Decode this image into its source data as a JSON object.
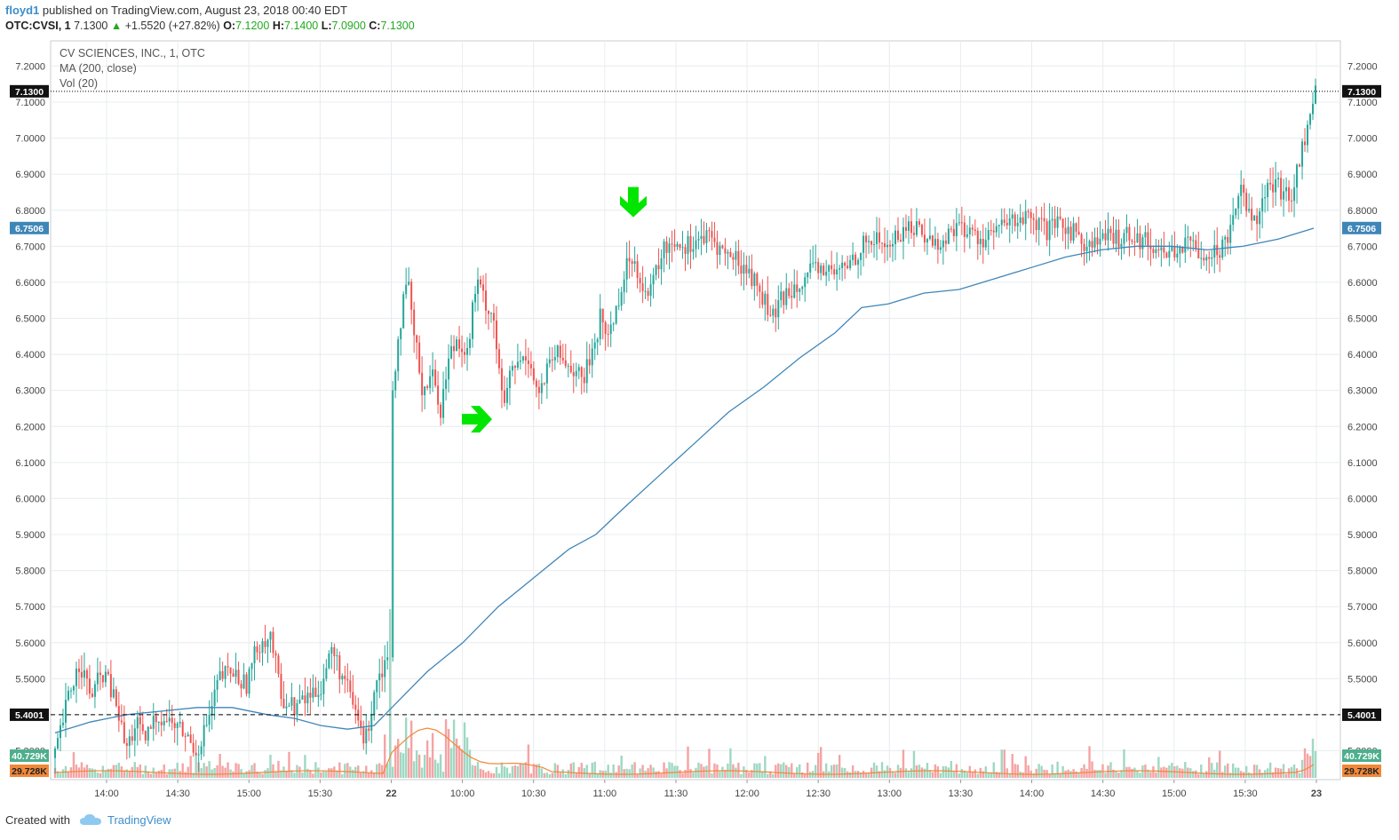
{
  "header": {
    "author": "floyd1",
    "published_text": "published on TradingView.com, August 23, 2018 00:40 EDT",
    "symbol": "OTC:CVSI, 1",
    "last": "7.1300",
    "change_arrow": "▲",
    "change": "+1.5520 (+27.82%)",
    "o_label": "O:",
    "o": "7.1200",
    "h_label": "H:",
    "h": "7.1400",
    "l_label": "L:",
    "l": "7.0900",
    "c_label": "C:",
    "c": "7.1300"
  },
  "legend": {
    "title": "CV SCIENCES, INC., 1, OTC",
    "ma": "MA (200, close)",
    "vol": "Vol (20)"
  },
  "footer": {
    "created_with": "Created with",
    "brand": "TradingView"
  },
  "colors": {
    "up": "#26a69a",
    "down": "#ef5350",
    "ma": "#3f86b8",
    "vol_ma": "#f0883a",
    "arrow": "#00e600",
    "grid": "#e8ecef"
  },
  "chart_data": {
    "type": "candlestick",
    "y_ticks": [
      "7.2000",
      "7.1000",
      "7.0000",
      "6.9000",
      "6.8000",
      "6.7000",
      "6.6000",
      "6.5000",
      "6.4000",
      "6.3000",
      "6.2000",
      "6.1000",
      "6.0000",
      "5.9000",
      "5.8000",
      "5.7000",
      "5.6000",
      "5.5000",
      "5.4000",
      "5.3000"
    ],
    "y_range": [
      5.22,
      7.27
    ],
    "x_ticks": [
      "14:00",
      "14:30",
      "15:00",
      "15:30",
      "22",
      "10:00",
      "10:30",
      "11:00",
      "11:30",
      "12:00",
      "12:30",
      "13:00",
      "13:30",
      "14:00",
      "14:30",
      "15:00",
      "15:30",
      "23"
    ],
    "last_price_label": "7.1300",
    "ma_label": "6.7506",
    "level_label": "5.4001",
    "volume_label": "40.729K",
    "volume_ma_label": "29.728K",
    "price_path": [
      [
        0,
        5.28
      ],
      [
        15,
        5.45
      ],
      [
        28,
        5.55
      ],
      [
        40,
        5.45
      ],
      [
        55,
        5.52
      ],
      [
        70,
        5.42
      ],
      [
        80,
        5.3
      ],
      [
        92,
        5.38
      ],
      [
        100,
        5.32
      ],
      [
        115,
        5.4
      ],
      [
        130,
        5.38
      ],
      [
        145,
        5.35
      ],
      [
        160,
        5.3
      ],
      [
        175,
        5.4
      ],
      [
        185,
        5.5
      ],
      [
        200,
        5.52
      ],
      [
        215,
        5.48
      ],
      [
        230,
        5.6
      ],
      [
        243,
        5.62
      ],
      [
        255,
        5.45
      ],
      [
        270,
        5.42
      ],
      [
        285,
        5.45
      ],
      [
        300,
        5.48
      ],
      [
        312,
        5.58
      ],
      [
        325,
        5.5
      ],
      [
        340,
        5.4
      ],
      [
        350,
        5.32
      ],
      [
        362,
        5.5
      ],
      [
        375,
        5.56
      ],
      [
        380,
        6.3
      ],
      [
        390,
        6.5
      ],
      [
        398,
        6.6
      ],
      [
        405,
        6.45
      ],
      [
        415,
        6.3
      ],
      [
        425,
        6.35
      ],
      [
        435,
        6.25
      ],
      [
        445,
        6.4
      ],
      [
        455,
        6.45
      ],
      [
        465,
        6.4
      ],
      [
        475,
        6.6
      ],
      [
        485,
        6.55
      ],
      [
        495,
        6.5
      ],
      [
        505,
        6.25
      ],
      [
        515,
        6.35
      ],
      [
        525,
        6.38
      ],
      [
        535,
        6.4
      ],
      [
        545,
        6.28
      ],
      [
        555,
        6.35
      ],
      [
        565,
        6.4
      ],
      [
        575,
        6.38
      ],
      [
        585,
        6.36
      ],
      [
        595,
        6.32
      ],
      [
        605,
        6.4
      ],
      [
        615,
        6.5
      ],
      [
        625,
        6.45
      ],
      [
        640,
        6.6
      ],
      [
        650,
        6.68
      ],
      [
        660,
        6.62
      ],
      [
        670,
        6.55
      ],
      [
        680,
        6.65
      ],
      [
        690,
        6.7
      ],
      [
        700,
        6.72
      ],
      [
        710,
        6.7
      ],
      [
        725,
        6.72
      ],
      [
        740,
        6.72
      ],
      [
        755,
        6.68
      ],
      [
        770,
        6.66
      ],
      [
        785,
        6.62
      ],
      [
        800,
        6.55
      ],
      [
        810,
        6.5
      ],
      [
        820,
        6.55
      ],
      [
        835,
        6.6
      ],
      [
        850,
        6.62
      ],
      [
        865,
        6.64
      ],
      [
        880,
        6.62
      ],
      [
        895,
        6.65
      ],
      [
        910,
        6.7
      ],
      [
        925,
        6.72
      ],
      [
        940,
        6.7
      ],
      [
        955,
        6.74
      ],
      [
        970,
        6.76
      ],
      [
        985,
        6.72
      ],
      [
        1000,
        6.7
      ],
      [
        1015,
        6.76
      ],
      [
        1030,
        6.74
      ],
      [
        1045,
        6.72
      ],
      [
        1060,
        6.74
      ],
      [
        1075,
        6.76
      ],
      [
        1090,
        6.78
      ],
      [
        1105,
        6.76
      ],
      [
        1120,
        6.74
      ],
      [
        1135,
        6.76
      ],
      [
        1150,
        6.74
      ],
      [
        1165,
        6.7
      ],
      [
        1180,
        6.72
      ],
      [
        1195,
        6.72
      ],
      [
        1210,
        6.74
      ],
      [
        1225,
        6.72
      ],
      [
        1240,
        6.7
      ],
      [
        1255,
        6.68
      ],
      [
        1270,
        6.7
      ],
      [
        1285,
        6.7
      ],
      [
        1300,
        6.68
      ],
      [
        1315,
        6.69
      ],
      [
        1325,
        6.75
      ],
      [
        1335,
        6.86
      ],
      [
        1345,
        6.82
      ],
      [
        1355,
        6.78
      ],
      [
        1365,
        6.85
      ],
      [
        1375,
        6.87
      ],
      [
        1385,
        6.85
      ],
      [
        1395,
        6.84
      ],
      [
        1405,
        6.95
      ],
      [
        1415,
        7.05
      ],
      [
        1422,
        7.13
      ]
    ],
    "ma_path": [
      [
        0,
        5.35
      ],
      [
        40,
        5.38
      ],
      [
        80,
        5.4
      ],
      [
        120,
        5.41
      ],
      [
        160,
        5.42
      ],
      [
        200,
        5.42
      ],
      [
        240,
        5.4
      ],
      [
        270,
        5.39
      ],
      [
        300,
        5.37
      ],
      [
        330,
        5.36
      ],
      [
        360,
        5.37
      ],
      [
        380,
        5.42
      ],
      [
        420,
        5.52
      ],
      [
        460,
        5.6
      ],
      [
        500,
        5.7
      ],
      [
        540,
        5.78
      ],
      [
        580,
        5.86
      ],
      [
        610,
        5.9
      ],
      [
        640,
        5.97
      ],
      [
        680,
        6.06
      ],
      [
        720,
        6.15
      ],
      [
        760,
        6.24
      ],
      [
        800,
        6.31
      ],
      [
        840,
        6.39
      ],
      [
        880,
        6.46
      ],
      [
        910,
        6.53
      ],
      [
        940,
        6.54
      ],
      [
        980,
        6.57
      ],
      [
        1020,
        6.58
      ],
      [
        1060,
        6.61
      ],
      [
        1100,
        6.64
      ],
      [
        1140,
        6.67
      ],
      [
        1180,
        6.69
      ],
      [
        1220,
        6.7
      ],
      [
        1260,
        6.7
      ],
      [
        1300,
        6.69
      ],
      [
        1340,
        6.7
      ],
      [
        1380,
        6.72
      ],
      [
        1420,
        6.75
      ]
    ],
    "arrows": [
      {
        "direction": "right",
        "x_index": 500,
        "price": 6.22
      },
      {
        "direction": "down",
        "x_index": 655,
        "price": 6.8
      }
    ]
  }
}
